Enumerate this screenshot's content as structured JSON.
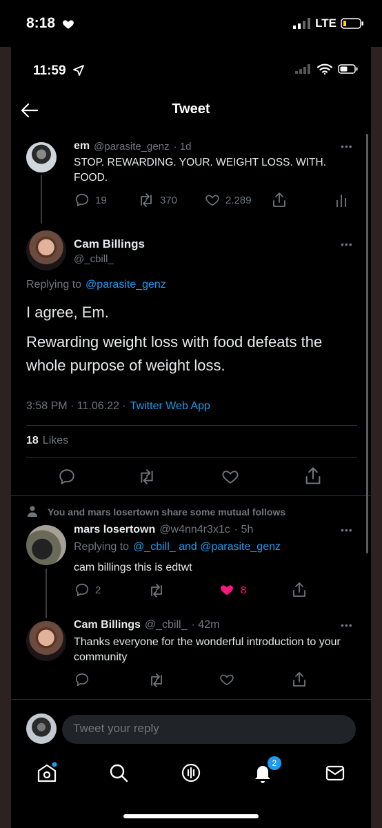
{
  "outer_status": {
    "time": "8:18",
    "network": "LTE"
  },
  "inner_status": {
    "time": "11:59"
  },
  "header": {
    "title": "Tweet"
  },
  "tweet_em": {
    "name": "em",
    "handle": "@parasite_genz",
    "age": "· 1d",
    "text": "STOP. REWARDING. YOUR. WEIGHT LOSS. WITH. FOOD.",
    "replies": "19",
    "retweets": "370",
    "likes": "2.289"
  },
  "main_tweet": {
    "name": "Cam Billings",
    "handle": "@_cbill_",
    "replying_label": "Replying to",
    "replying_to": "@parasite_genz",
    "text1": "I agree, Em.",
    "text2": "Rewarding weight loss with food defeats the whole purpose of weight loss.",
    "timestamp": "3:58 PM · 11.06.22 ·",
    "app": "Twitter Web App",
    "likes_count": "18",
    "likes_label": "Likes"
  },
  "mutual_note": "You and mars losertown share some mutual follows",
  "reply_mars": {
    "name": "mars losertown",
    "handle": "@w4nn4r3x1c",
    "age": "· 5h",
    "replying_label": "Replying to",
    "replying_to": "@_cbill_ and @parasite_genz",
    "text": "cam billings this is edtwt",
    "replies": "2",
    "likes": "8"
  },
  "reply_cam": {
    "name": "Cam Billings",
    "handle": "@_cbill_",
    "age": "· 42m",
    "text": "Thanks everyone for the wonderful introduction to your community"
  },
  "compose": {
    "placeholder": "Tweet your reply"
  },
  "tabs": {
    "notifications_badge": "2"
  },
  "colors": {
    "accent": "#1d9bf0",
    "like": "#f91880",
    "background": "#000000"
  }
}
